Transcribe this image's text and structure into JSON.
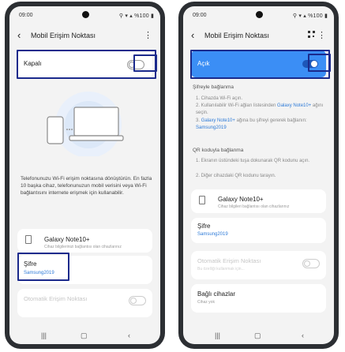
{
  "left": {
    "status": {
      "time": "09:00",
      "right": "⚲ ▾ ▴ %100 ▮"
    },
    "appbar": {
      "title": "Mobil Erişim Noktası"
    },
    "toggle": {
      "label": "Kapalı"
    },
    "description": "Telefonunuzu Wi-Fi erişim noktasına dönüştürün. En fazla 10 başka cihaz, telefonunuzun mobil verisini veya Wi-Fi bağlantısını internete erişmek için kullanabilir.",
    "network": {
      "name": "Galaxy Note10+",
      "sub": "Cihaz bilgilerinizi bağlantısı olan cihazlarınız"
    },
    "password": {
      "title": "Şifre",
      "value": "Samsung2019"
    },
    "auto_hotspot": {
      "title": "Otomatik Erişim Noktası"
    }
  },
  "right": {
    "status": {
      "time": "09:00",
      "right": "⚲ ▾ ▴ %100 ▮"
    },
    "appbar": {
      "title": "Mobil Erişim Noktası"
    },
    "toggle": {
      "label": "Açık"
    },
    "password_conn": {
      "header": "Şifreyle bağlanma",
      "step1": "1. Cihazda Wi-Fi açın.",
      "step2a": "2. Kullanılabilir Wi-Fi ağları listesinden",
      "step2b": "Galaxy Note10+",
      "step2c": "ağını seçin.",
      "step3a": "3.",
      "step3b": "Galaxy Note10+",
      "step3c": "ağına bu şifreyi gererek bağlanın:",
      "step3d": "Samsung2019"
    },
    "qr_conn": {
      "header": "QR koduyla bağlanma",
      "step1": "1. Ekranın üstündeki tuşa dokunarak QR kodunu açın.",
      "step2": "2. Diğer cihazdaki QR kodunu tarayın."
    },
    "network": {
      "name": "Galaxy Note10+",
      "sub": "Cihaz bilgileri bağlantısı olan cihazlarınız"
    },
    "password": {
      "title": "Şifre",
      "value": "Samsung2019"
    },
    "auto_hotspot": {
      "title": "Otomatik Erişim Noktası",
      "sub": "Bu özelliği kullanmak için..."
    },
    "connected": {
      "title": "Bağlı cihazlar",
      "value": "Cihaz yok"
    }
  },
  "colors": {
    "accent": "#3b8ef5",
    "highlight": "#1b2a8c",
    "link": "#2e7bd8"
  },
  "icons": {
    "back": "back-arrow-icon",
    "more": "more-options-icon",
    "qr": "qr-code-icon"
  }
}
